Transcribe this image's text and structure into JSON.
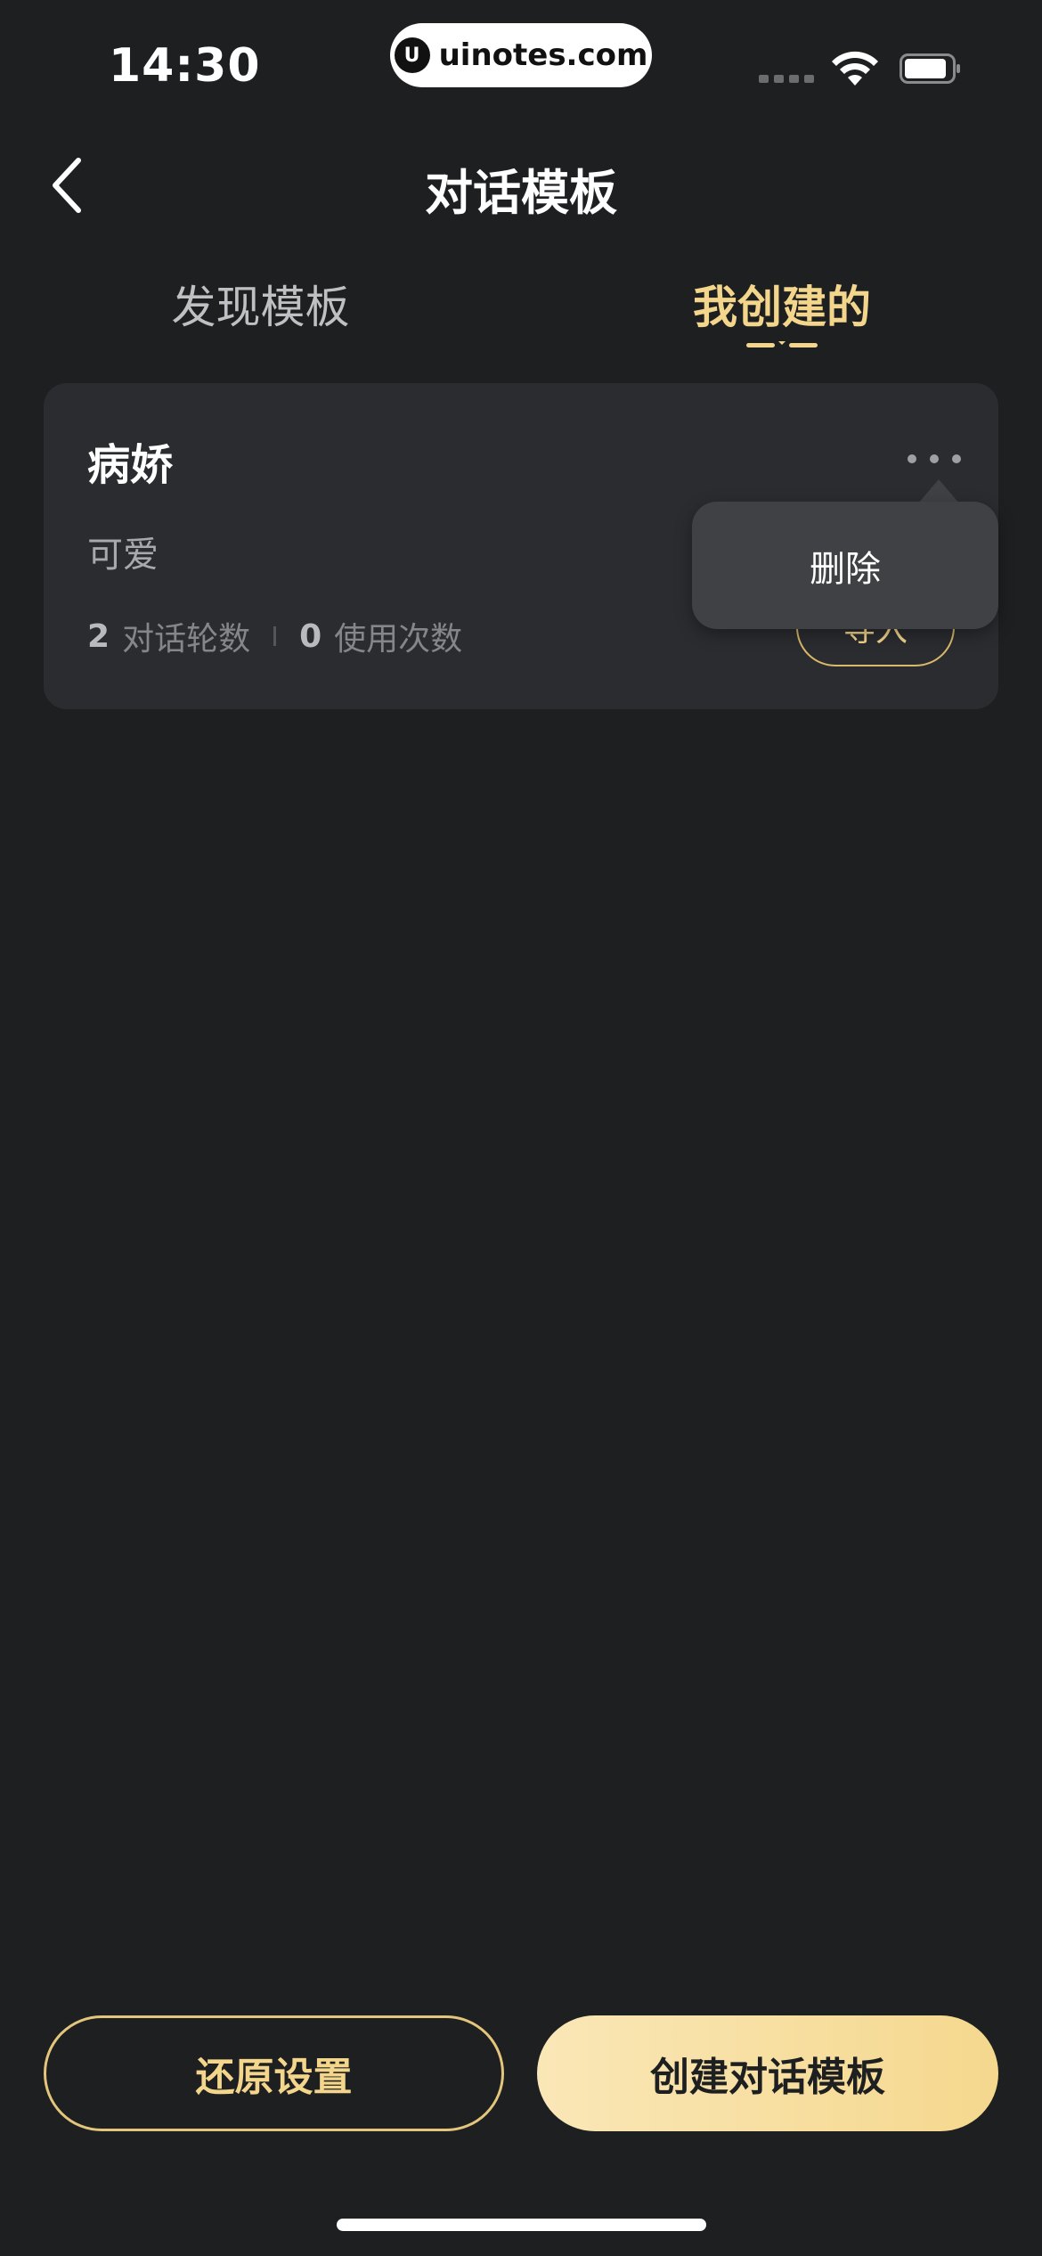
{
  "status_bar": {
    "time": "14:30",
    "watermark_text": "uinotes.com",
    "watermark_logo": "U",
    "icons": [
      "cellular-icon",
      "wifi-icon",
      "battery-icon"
    ]
  },
  "nav": {
    "title": "对话模板",
    "back_icon": "chevron-left-icon"
  },
  "tabs": [
    {
      "label": "发现模板",
      "active": false
    },
    {
      "label": "我创建的",
      "active": true
    }
  ],
  "template_card": {
    "title": "病娇",
    "description": "可爱",
    "stats": [
      {
        "value": "2",
        "label": "对话轮数"
      },
      {
        "value": "0",
        "label": "使用次数"
      }
    ],
    "import_label": "导入",
    "more_icon": "more-dots-icon"
  },
  "popover_menu": {
    "items": [
      "删除"
    ]
  },
  "bottom_actions": {
    "reset_label": "还原设置",
    "create_label": "创建对话模板"
  },
  "colors": {
    "background": "#1e1f21",
    "card": "#2b2c30",
    "accent_gold": "#f3d68b",
    "popover": "#404145"
  }
}
